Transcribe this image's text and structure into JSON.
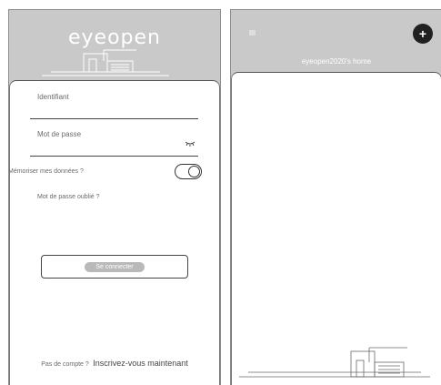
{
  "login": {
    "logo": "eyeopen",
    "identifiant_label": "Identifiant",
    "password_label": "Mot de passe",
    "remember_label": "Mémoriser mes données ?",
    "remember_on": true,
    "forgot_label": "Mot de passe oublié ?",
    "connect_label": "Se connecter",
    "no_account_label": "Pas de compte ?",
    "signup_link": "Inscrivez-vous maintenant"
  },
  "home": {
    "title": "eyeopen2020's home",
    "add_icon": "+",
    "menu_icon": "≡"
  },
  "colors": {
    "header_bg": "#c9c9c9",
    "card_bg": "#ffffff",
    "accent_dark": "#202020"
  }
}
